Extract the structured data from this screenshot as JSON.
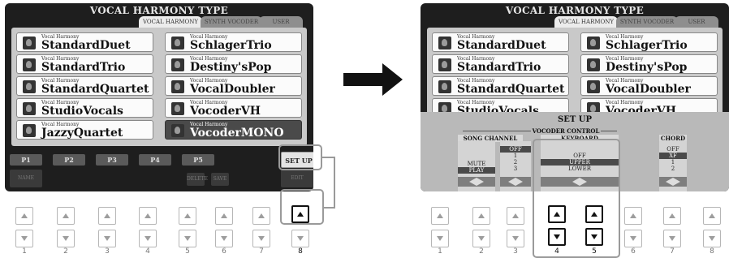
{
  "screen_title": "VOCAL HARMONY TYPE",
  "tabs": [
    "VOCAL HARMONY",
    "SYNTH VOCODER",
    "USER"
  ],
  "types": [
    {
      "category": "Vocal Harmony",
      "name": "StandardDuet"
    },
    {
      "category": "Vocal Harmony",
      "name": "SchlagerTrio"
    },
    {
      "category": "Vocal Harmony",
      "name": "StandardTrio"
    },
    {
      "category": "Vocal Harmony",
      "name": "Destiny'sPop"
    },
    {
      "category": "Vocal Harmony",
      "name": "StandardQuartet"
    },
    {
      "category": "Vocal Harmony",
      "name": "VocalDoubler"
    },
    {
      "category": "Vocal Harmony",
      "name": "StudioVocals"
    },
    {
      "category": "Vocal Harmony",
      "name": "VocoderVH"
    },
    {
      "category": "Vocal Harmony",
      "name": "JazzyQuartet"
    },
    {
      "category": "Vocal Harmony",
      "name": "VocoderMONO"
    }
  ],
  "page_buttons": [
    "P1",
    "P2",
    "P3",
    "P4",
    "P5"
  ],
  "setup_label": "SET UP",
  "function_buttons": {
    "name": "NAME",
    "delete": "DELETE",
    "save": "SAVE",
    "edit": "EDIT"
  },
  "setup": {
    "title": "SET UP",
    "group": "VOCODER CONTROL",
    "song_channel": {
      "title": "SONG CHANNEL",
      "col_a": [
        "MUTE",
        "PLAY"
      ],
      "col_a_selected": "PLAY",
      "col_b": [
        "OFF",
        "1",
        "2",
        "3"
      ],
      "col_b_selected": "OFF"
    },
    "keyboard": {
      "title": "KEYBOARD",
      "options": [
        "OFF",
        "UPPER",
        "LOWER"
      ],
      "selected": "UPPER"
    },
    "chord": {
      "title": "CHORD",
      "options": [
        "OFF",
        "XF",
        "1",
        "2"
      ],
      "selected": "XF"
    }
  },
  "button_numbers": [
    "1",
    "2",
    "3",
    "4",
    "5",
    "6",
    "7",
    "8"
  ],
  "colors": {
    "screen_bg": "#1e1e1e",
    "panel": "#c9c9c9",
    "highlight": "#111111"
  }
}
